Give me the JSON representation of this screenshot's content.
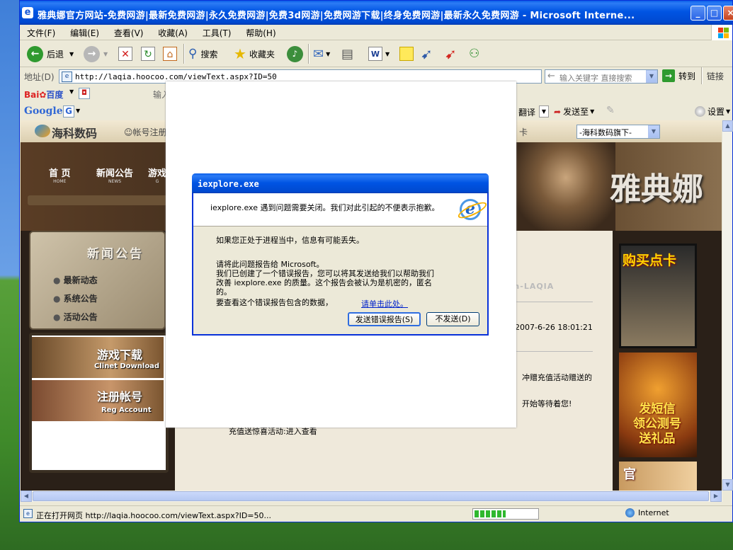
{
  "window": {
    "title": "雅典娜官方网站-免费网游|最新免费网游|永久免费网游|免费3d网游|免费网游下载|终身免费网游|最新永久免费网游 - Microsoft Interne...",
    "title_icon": "e"
  },
  "menubar": [
    "文件(F)",
    "编辑(E)",
    "查看(V)",
    "收藏(A)",
    "工具(T)",
    "帮助(H)"
  ],
  "toolbar": {
    "back": "后退",
    "search": "搜索",
    "favorites": "收藏夹"
  },
  "addressbar": {
    "label": "地址(D)",
    "url": "http://laqia.hoocoo.com/viewText.aspx?ID=50",
    "keyword_placeholder": "输入关键字 直接搜索",
    "go": "转到",
    "links": "链接"
  },
  "baidubar": {
    "logo_left": "Bai",
    "logo_right": "百度",
    "input_hint": "输入"
  },
  "googlebar": {
    "logo": "Google",
    "translate": "翻译",
    "sendto": "发送至",
    "settings": "设置"
  },
  "site": {
    "brand": "海科数码",
    "account": "帐号注册",
    "card": "卡",
    "select_value": "-海科数码旗下-",
    "nav": [
      {
        "cn": "首 页",
        "en": "HOME"
      },
      {
        "cn": "新闻公告",
        "en": "NEWS"
      },
      {
        "cn": "游戏",
        "en": "G"
      }
    ],
    "news_title": "新闻公告",
    "news_items": [
      "最新动态",
      "系统公告",
      "活动公告"
    ],
    "download": {
      "cn": "游戏下载",
      "en": "Clinet Download"
    },
    "register": {
      "cn": "注册帐号",
      "en": "Reg Account"
    },
    "game_logo": "雅典娜",
    "buy_card": "购买点卡",
    "sms": [
      "发短信",
      "领公测号",
      "送礼品"
    ],
    "sms_bottom": "官",
    "article_sub": "ution-LAQIA",
    "article_date": "2007-6-26 18:01:21",
    "article_line1": "冲赠充值活动赠送的",
    "article_line2": "开始等待着您!",
    "article_line3": "充值送惊喜活动:进入查看"
  },
  "dialog": {
    "title": "iexplore.exe",
    "message": "iexplore.exe 遇到问题需要关闭。我们对此引起的不便表示抱歉。",
    "info": "如果您正处于进程当中，信息有可能丢失。",
    "report_l1": "请将此问题报告给 Microsoft。",
    "report_l2": "我们已创建了一个错误报告，您可以将其发送给我们以帮助我们",
    "report_l3": "改善 iexplore.exe 的质量。这个报告会被认为是机密的，匿名",
    "report_l4": "的。",
    "see_data": "要查看这个错误报告包含的数据，",
    "click_here": "请单击此处。",
    "send_button": "发送错误报告(S)",
    "dont_send_button": "不发送(D)"
  },
  "status": {
    "text": "正在打开网页 http://laqia.hoocoo.com/viewText.aspx?ID=50...",
    "zone": "Internet",
    "progress": 0.5
  }
}
